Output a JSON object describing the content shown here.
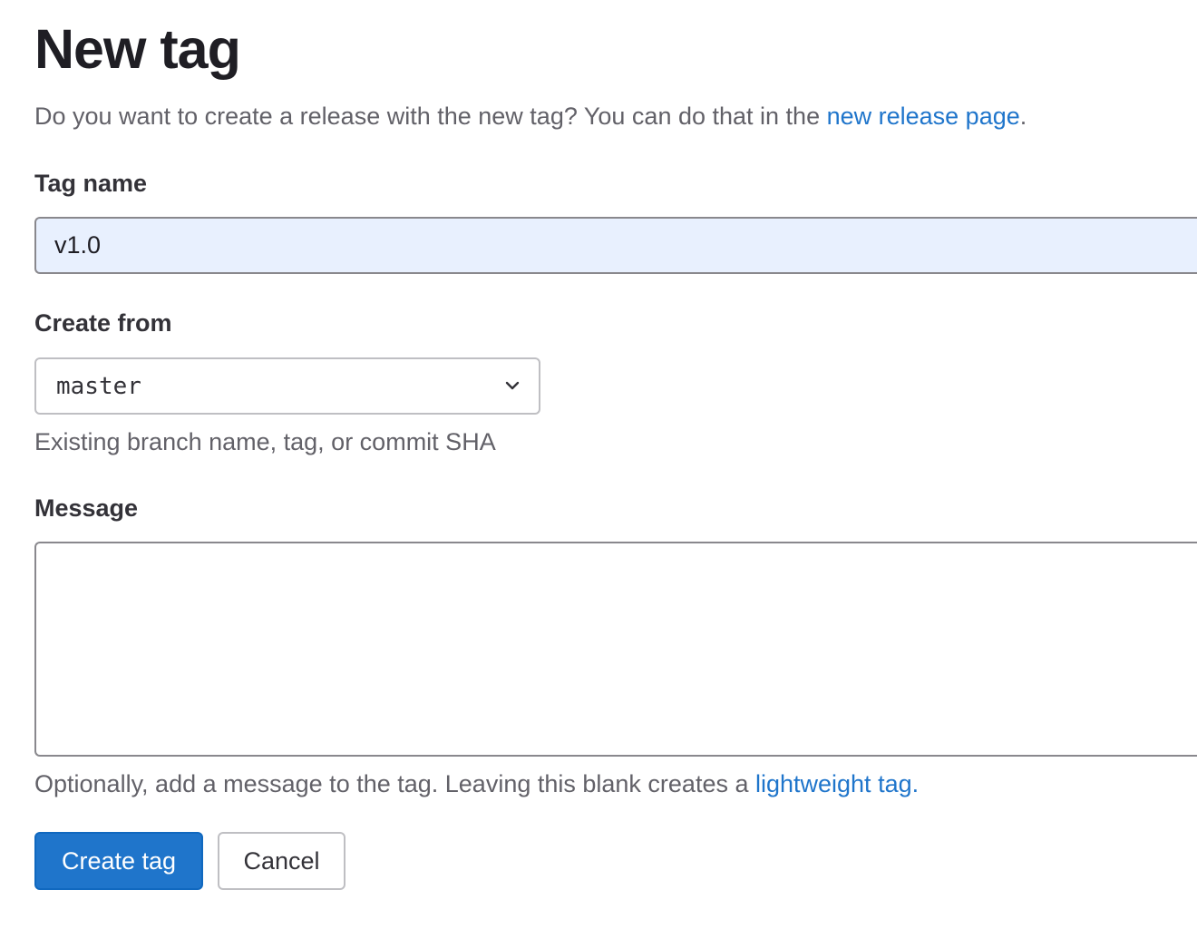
{
  "page": {
    "title": "New tag",
    "intro_text": "Do you want to create a release with the new tag? You can do that in the ",
    "intro_link": "new release page",
    "intro_end": "."
  },
  "tag_name": {
    "label": "Tag name",
    "value": "v1.0"
  },
  "create_from": {
    "label": "Create from",
    "selected": "master",
    "help": "Existing branch name, tag, or commit SHA",
    "icon": "chevron-down-icon"
  },
  "message": {
    "label": "Message",
    "value": "",
    "help_text": "Optionally, add a message to the tag. Leaving this blank creates a ",
    "help_link": "lightweight tag",
    "help_end": "."
  },
  "actions": {
    "create_label": "Create tag",
    "cancel_label": "Cancel"
  },
  "colors": {
    "primary": "#1f75cb",
    "link": "#1f75cb",
    "autofill_bg": "#e8f0fe"
  }
}
